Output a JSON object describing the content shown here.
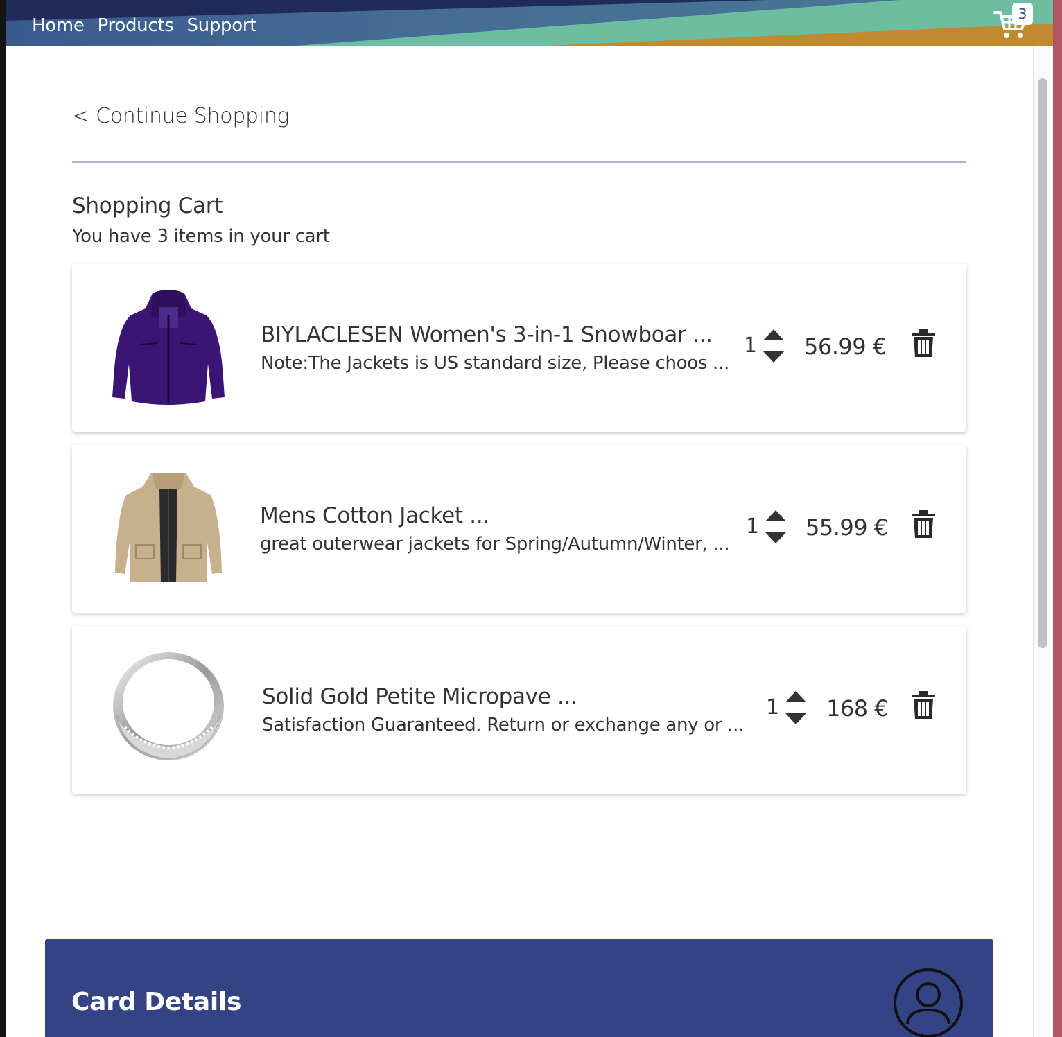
{
  "nav": {
    "links": [
      "Home",
      "Products",
      "Support"
    ],
    "cart_count": "3"
  },
  "cart": {
    "continue_label": "< Continue Shopping",
    "title": "Shopping Cart",
    "subtitle": "You have 3 items in your cart",
    "items": [
      {
        "name": "BIYLACLESEN Women's 3-in-1 Snowboar ...",
        "description": "Note:The Jackets is US standard size, Please choos ...",
        "quantity": "1",
        "price": "56.99 €",
        "image": "purple-jacket"
      },
      {
        "name": "Mens Cotton Jacket ...",
        "description": "great outerwear jackets for Spring/Autumn/Winter, ...",
        "quantity": "1",
        "price": "55.99 €",
        "image": "khaki-jacket"
      },
      {
        "name": "Solid Gold Petite Micropave ...",
        "description": "Satisfaction Guaranteed. Return or exchange any or ...",
        "quantity": "1",
        "price": "168 €",
        "image": "silver-ring"
      }
    ]
  },
  "card_details": {
    "title": "Card Details"
  },
  "colors": {
    "panel": "#344384",
    "divider": "#a9b6dc",
    "nav_dark": "#1e2f5e",
    "nav_teal": "#6dbea0",
    "nav_orange": "#c28a2e"
  }
}
